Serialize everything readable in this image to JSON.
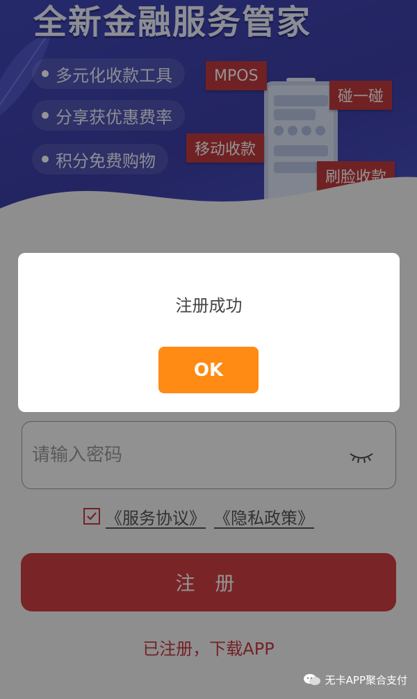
{
  "banner": {
    "title": "全新金融服务管家",
    "features": [
      "多元化收款工具",
      "分享获优惠费率",
      "积分免费购物"
    ],
    "tags": [
      "MPOS",
      "碰一碰",
      "移动收款",
      "刷脸收款"
    ]
  },
  "form": {
    "password_placeholder": "请输入密码",
    "agreement_checked": true,
    "service_agreement": "《服务协议》",
    "privacy_policy": "《隐私政策》",
    "register_label": "注 册",
    "download_link": "已注册，下载APP"
  },
  "dialog": {
    "message": "注册成功",
    "ok_label": "OK"
  },
  "watermark": {
    "text": "无卡APP聚合支付"
  },
  "colors": {
    "brand_red": "#d13e43",
    "ok_orange": "#ff8a14",
    "banner_blue": "#4048b8"
  }
}
